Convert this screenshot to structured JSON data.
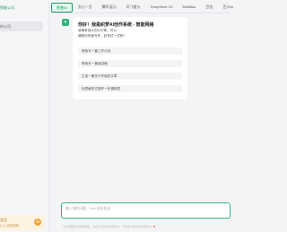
{
  "sidebar": {
    "top_label": "智能公司",
    "items": [
      {
        "label": "的公司"
      }
    ],
    "promo": {
      "title": "会员",
      "subtitle": "以上 完善资料",
      "badge": "≫"
    }
  },
  "tabs": [
    {
      "label": "智普AI",
      "active": true
    },
    {
      "label": "文心一言",
      "active": false
    },
    {
      "label": "腾讯混元",
      "active": false
    },
    {
      "label": "讯飞星火",
      "active": false
    },
    {
      "label": "DeepSeek V3",
      "active": false
    },
    {
      "label": "MiniMax",
      "active": false
    },
    {
      "label": "豆包",
      "active": false
    },
    {
      "label": "百川AI",
      "active": false
    }
  ],
  "chat": {
    "title": "你好！我是织梦AI创作系统 - 智能网络",
    "line1": "我拥有强大的AI引擎，可以",
    "line2": "辅助你快速写作，赶快试一试吧！",
    "suggestions": [
      "帮我写一篇工作计划",
      "帮我写一篇演讲稿",
      "生成一篇关于环保的文章",
      "用表格形式制作一份课程表"
    ]
  },
  "input": {
    "placeholder": "输入你的问题，Ctrl+回车发送"
  },
  "footer": {
    "text": "请仔细甄别内容准确性，本站不对生成内容负责，对使用AI生成的内容负责"
  }
}
